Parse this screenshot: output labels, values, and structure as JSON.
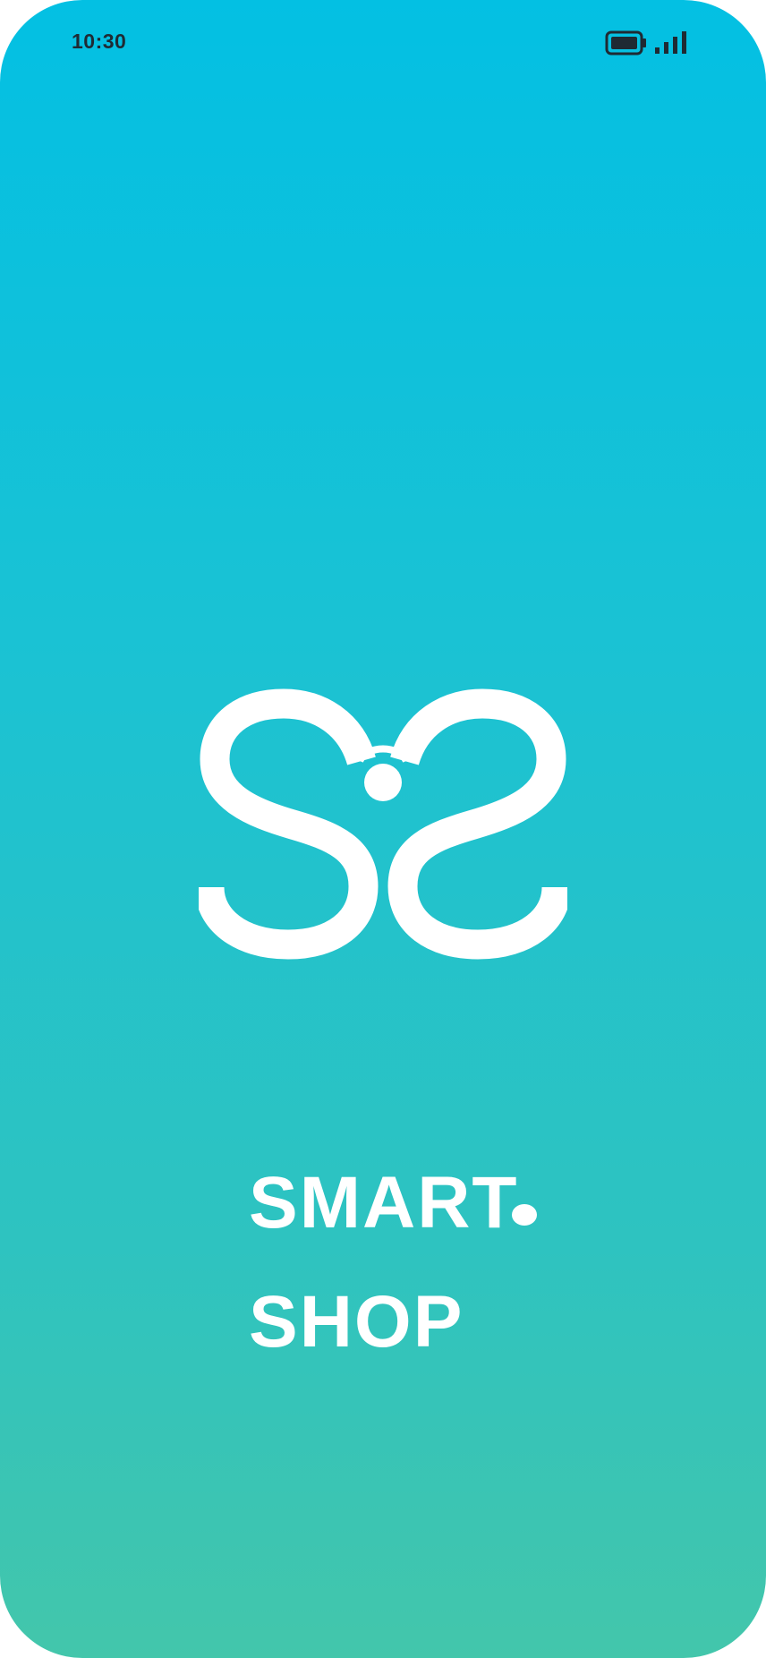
{
  "status_bar": {
    "time": "10:30",
    "icons": [
      "battery-icon",
      "signal-icon"
    ]
  },
  "splash": {
    "logo_icon": "double-s-heart-logo-icon",
    "brand_line_1": "SMART",
    "brand_line_2": "SHOP"
  },
  "colors": {
    "gradient_top": "#03c0e3",
    "gradient_bottom": "#43c6ab",
    "foreground": "#ffffff",
    "status_text": "#1f2a33"
  }
}
